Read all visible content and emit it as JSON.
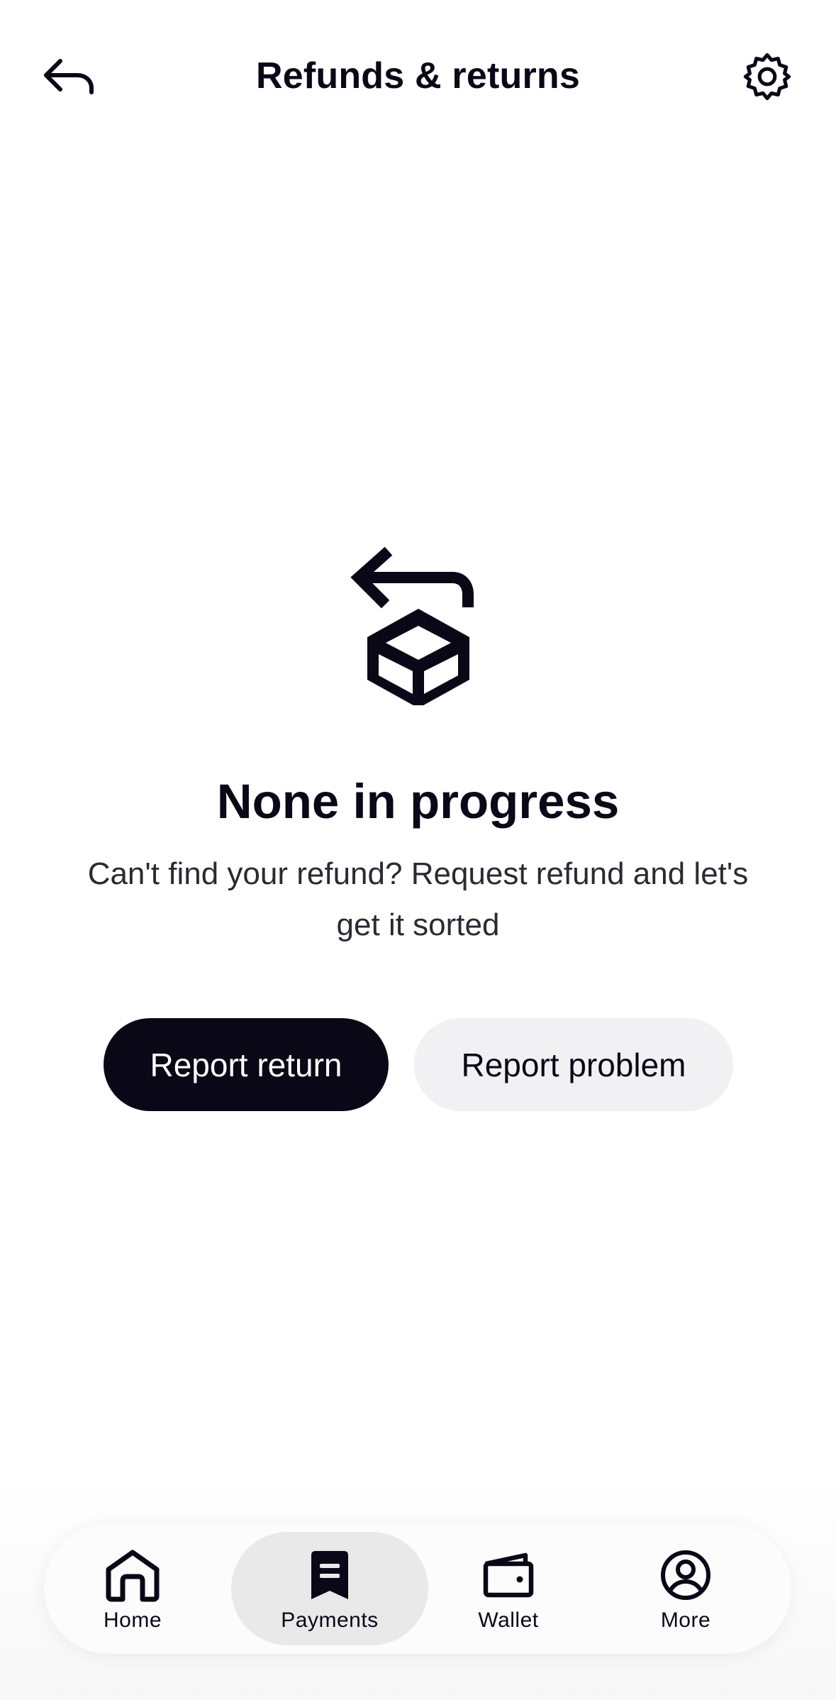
{
  "header": {
    "title": "Refunds & returns",
    "back_icon": "back-arrow-icon",
    "settings_icon": "gear-icon"
  },
  "empty_state": {
    "icon": "box-return-icon",
    "title": "None in progress",
    "description": "Can't find your refund? Request refund and let's get it sorted"
  },
  "actions": {
    "report_return_label": "Report return",
    "report_problem_label": "Report problem"
  },
  "tabbar": {
    "items": [
      {
        "label": "Home",
        "icon": "home-icon",
        "active": false
      },
      {
        "label": "Payments",
        "icon": "receipt-icon",
        "active": true
      },
      {
        "label": "Wallet",
        "icon": "wallet-icon",
        "active": false
      },
      {
        "label": "More",
        "icon": "profile-icon",
        "active": false
      }
    ]
  },
  "colors": {
    "primary": "#0a0817",
    "secondary_button_bg": "#f1f1f4",
    "active_tab_bg": "#e9e9ea",
    "background": "#ffffff"
  }
}
